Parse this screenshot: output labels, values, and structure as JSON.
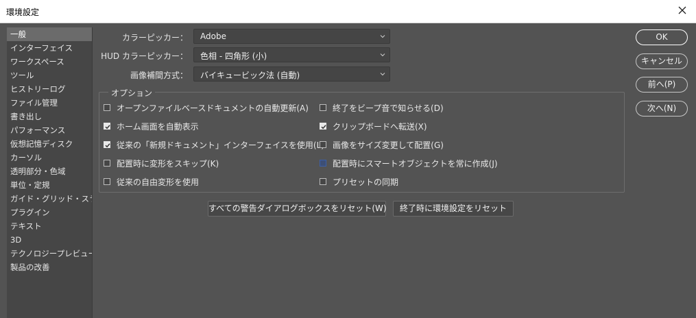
{
  "window": {
    "title": "環境設定"
  },
  "sidebar": {
    "items": [
      "一般",
      "インターフェイス",
      "ワークスペース",
      "ツール",
      "ヒストリーログ",
      "ファイル管理",
      "書き出し",
      "パフォーマンス",
      "仮想記憶ディスク",
      "カーソル",
      "透明部分・色域",
      "単位・定規",
      "ガイド・グリッド・スライス",
      "プラグイン",
      "テキスト",
      "3D",
      "テクノロジープレビュー",
      "製品の改善"
    ],
    "selected_index": 0
  },
  "settings": {
    "color_picker_label": "カラーピッカー：",
    "color_picker_value": "Adobe",
    "hud_picker_label": "HUD カラーピッカー：",
    "hud_picker_value": "色相 - 四角形 (小)",
    "interp_label": "画像補間方式：",
    "interp_value": "バイキュービック法 (自動)"
  },
  "options": {
    "title": "オプション",
    "left": [
      {
        "label": "オープンファイルベースドキュメントの自動更新(A)",
        "checked": false
      },
      {
        "label": "ホーム画面を自動表示",
        "checked": true
      },
      {
        "label": "従来の「新規ドキュメント」インターフェイスを使用(L)",
        "checked": true
      },
      {
        "label": "配置時に変形をスキップ(K)",
        "checked": false
      },
      {
        "label": "従来の自由変形を使用",
        "checked": false
      }
    ],
    "right": [
      {
        "label": "終了をビープ音で知らせる(D)",
        "checked": false
      },
      {
        "label": "クリップボードへ転送(X)",
        "checked": true
      },
      {
        "label": "画像をサイズ変更して配置(G)",
        "checked": false
      },
      {
        "label": "配置時にスマートオブジェクトを常に作成(J)",
        "checked": false
      },
      {
        "label": "プリセットの同期",
        "checked": false
      }
    ]
  },
  "buttons": {
    "reset_warnings": "すべての警告ダイアログボックスをリセット(W)",
    "reset_on_quit": "終了時に環境設定をリセット",
    "ok": "OK",
    "cancel": "キャンセル",
    "prev": "前へ(P)",
    "next": "次へ(N)"
  },
  "icons": {
    "close": "close-icon",
    "dropdown": "chevron-down-icon",
    "check": "checkmark-icon"
  }
}
